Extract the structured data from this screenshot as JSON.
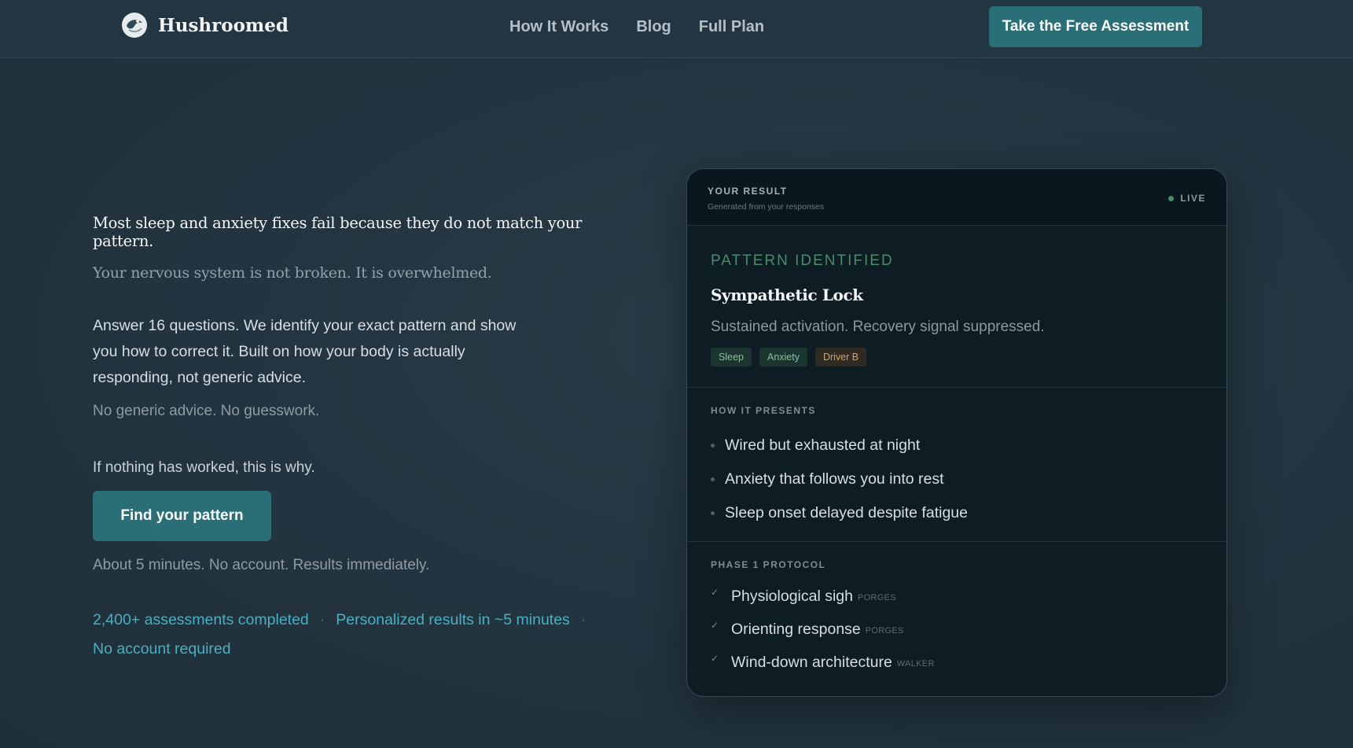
{
  "brand": {
    "name": "Hushroomed"
  },
  "nav": {
    "links": [
      "How It Works",
      "Blog",
      "Full Plan"
    ],
    "cta": "Take the Free Assessment"
  },
  "hero": {
    "title": "Most sleep and anxiety fixes fail because they do not match your pattern.",
    "subtitle": "Your nervous system is not broken. It is overwhelmed.",
    "body": "Answer 16 questions. We identify your exact pattern and show you how to correct it. Built on how your body is actually responding, not generic advice.",
    "muted": "No generic advice. No guesswork.",
    "nothing_worked": "If nothing has worked, this is why.",
    "button": "Find your pattern",
    "about": "About 5 minutes. No account. Results immediately.",
    "stats": [
      "2,400+ assessments completed",
      "Personalized results in ~5 minutes",
      "No account required"
    ]
  },
  "card": {
    "label": "YOUR RESULT",
    "sub": "Generated from your responses",
    "live": "LIVE",
    "pattern_label": "PATTERN IDENTIFIED",
    "pattern_name": "Sympathetic Lock",
    "pattern_desc": "Sustained activation. Recovery signal suppressed.",
    "tags": [
      "Sleep",
      "Anxiety",
      "Driver B"
    ],
    "presents_label": "HOW IT PRESENTS",
    "presents": [
      "Wired but exhausted at night",
      "Anxiety that follows you into rest",
      "Sleep onset delayed despite fatigue"
    ],
    "protocol_label": "PHASE 1 PROTOCOL",
    "protocol": [
      {
        "name": "Physiological sigh",
        "source": "PORGES"
      },
      {
        "name": "Orienting response",
        "source": "PORGES"
      },
      {
        "name": "Wind-down architecture",
        "source": "WALKER"
      }
    ]
  }
}
